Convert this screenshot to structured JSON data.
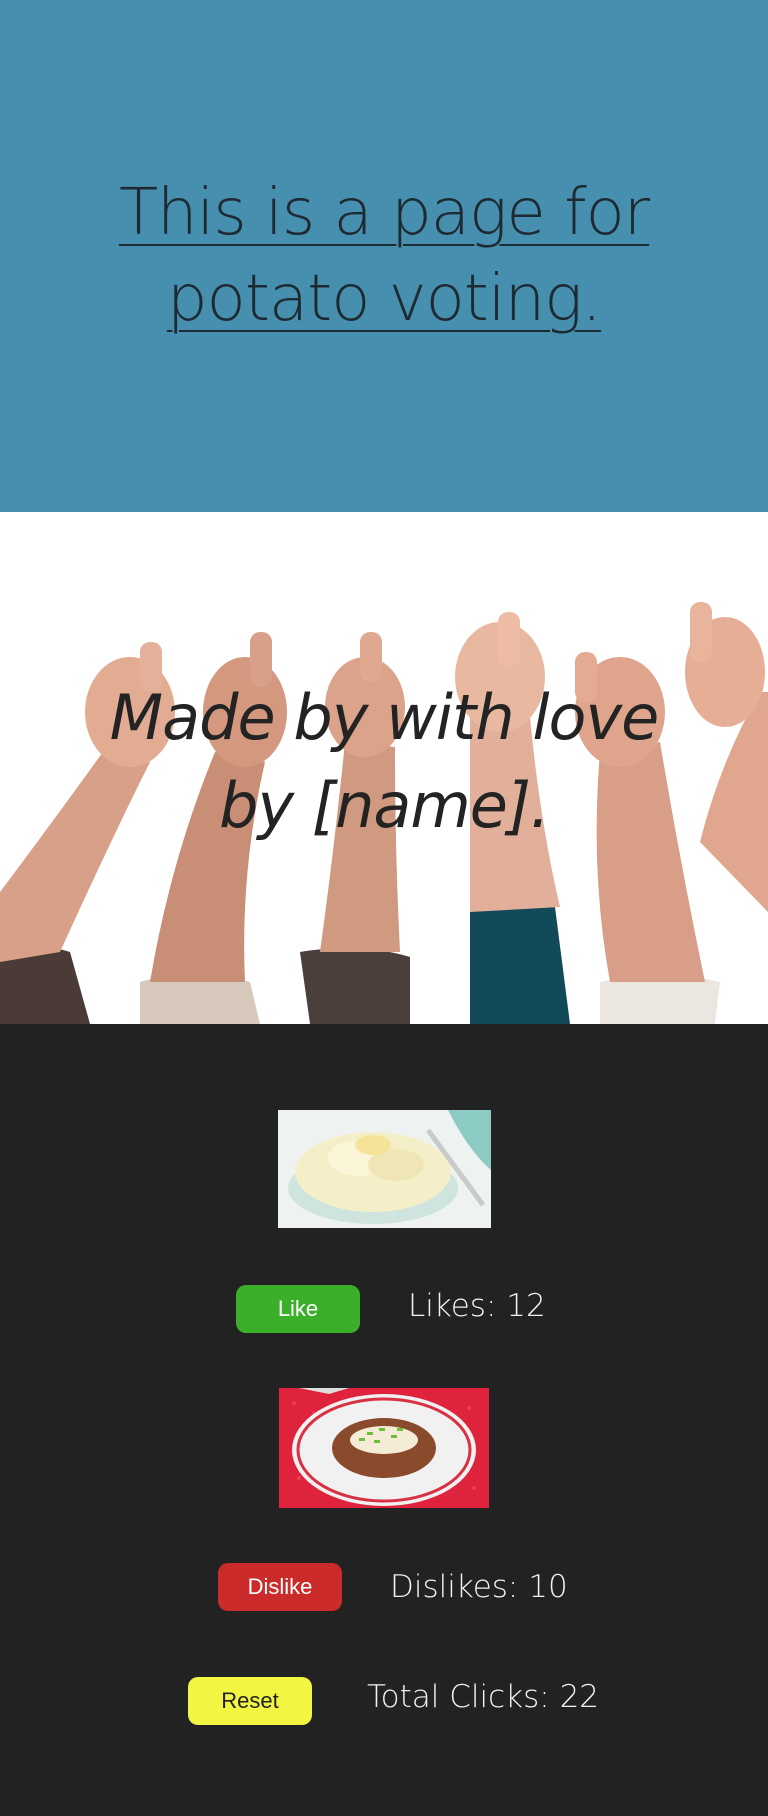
{
  "header": {
    "title": "This is a page for potato voting."
  },
  "hero": {
    "tagline": "Made by with love by [name]."
  },
  "voting": {
    "like": {
      "button_label": "Like",
      "count_text": "Likes: 12",
      "image": "mashed-potatoes-photo"
    },
    "dislike": {
      "button_label": "Dislike",
      "count_text": "Dislikes: 10",
      "image": "baked-potato-photo"
    },
    "reset": {
      "button_label": "Reset",
      "total_text": "Total Clicks: 22"
    }
  },
  "colors": {
    "header_bg": "#468faf",
    "page_bg": "#222222",
    "like": "#3caf2a",
    "dislike": "#cc2b2b",
    "reset": "#f2f542"
  }
}
